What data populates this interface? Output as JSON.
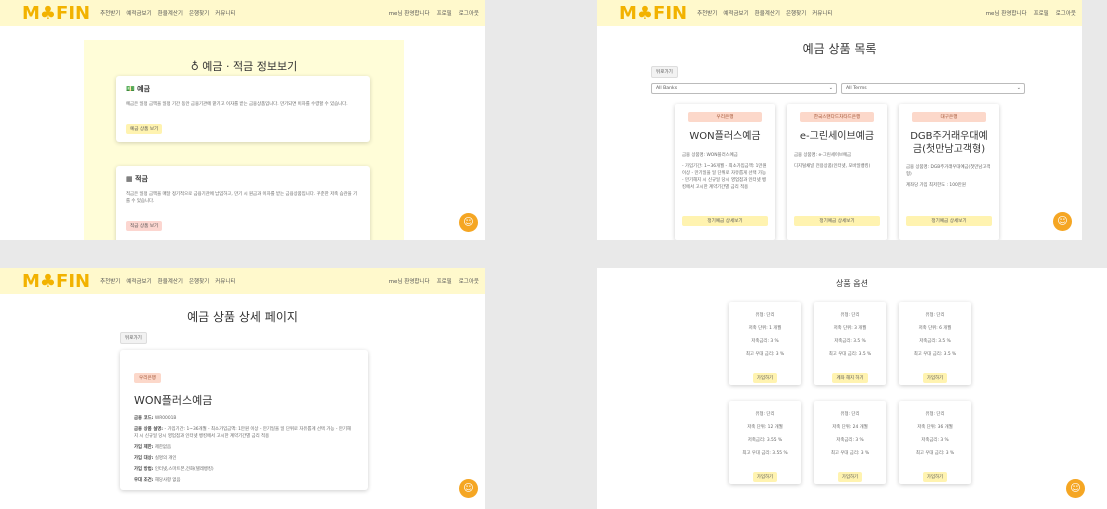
{
  "nav": {
    "logo": "M♣FIN",
    "links": [
      "추천받기",
      "예적금보기",
      "환율계산기",
      "은행찾기",
      "커뮤니티"
    ],
    "user_greeting": "me님 환영합니다",
    "profile": "프로필",
    "logout": "로그아웃"
  },
  "chat_icon": "chatbot-icon",
  "info_page": {
    "title": "♁ 예금 · 적금 정보보기",
    "deposit": {
      "heading": "💵 예금",
      "desc": "예금은 일정 금액을 일정 기간 동안 금융기관에 맡기고 이자를 받는 금융상품입니다. 만기되면 이자를 수령할 수 있습니다.",
      "button": "예금 상품 보기"
    },
    "saving": {
      "heading": "▦ 적금",
      "desc": "적금은 일정 금액을 매달 정기적으로 금융기관에 납입하고, 만기 시 원금과 이자를 받는 금융상품입니다. 꾸준한 저축 습관을 기를 수 있습니다.",
      "button": "적금 상품 보기"
    }
  },
  "list_page": {
    "title": "예금 상품 목록",
    "back": "뒤로가기",
    "bank_filter": "All Banks",
    "term_filter": "All Terms",
    "products": [
      {
        "bank": "우리은행",
        "name": "WON플러스예금",
        "lines": [
          "금융 상품명: WON플러스예금",
          "- 가입기간: 1~36개월 - 최소가입금액: 1만원 이상 - 만기일을 일 단위로 자유롭게 선택 가능 - 만기해지 시 신규일 당시 영업점과 인터넷 뱅킹에서 고시한 계약기간별 금리 적용"
        ],
        "button": "정기예금 상세보기"
      },
      {
        "bank": "한국스탠다드차타드은행",
        "name": "e-그린세이브예금",
        "lines": [
          "금융 상품명: e-그린세이브예금",
          "디지털채널 전용상품(인터넷, 모바일뱅킹)"
        ],
        "button": "정기예금 상세보기"
      },
      {
        "bank": "대구은행",
        "name": "DGB주거래우대예금(첫만남고객형)",
        "lines": [
          "금융 상품명: DGB주거래우대예금(첫만남고객형)",
          "계좌당 가입 최저한도 : 100만원"
        ],
        "button": "정기예금 상세보기"
      }
    ]
  },
  "detail_page": {
    "title": "예금 상품 상세 페이지",
    "back": "뒤로가기",
    "bank": "우리은행",
    "name": "WON플러스예금",
    "code_label": "금융 코드:",
    "code": "WR0001B",
    "desc_label": "금융 상품 설명:",
    "desc": "- 가입기간: 1~36개월 - 최소가입금액: 1만원 이상 - 만기일을 일 단위로 자유롭게 선택 가능 - 만기해지 시 신규일 당시 영업점과 인터넷 뱅킹에서 고시한 계약기간별 금리 적용",
    "restriction_label": "가입 제한:",
    "restriction": "제한없음",
    "target_label": "가입 대상:",
    "target": "실명의 개인",
    "method_label": "가입 방법:",
    "method": "인터넷,스마트폰,전화(텔레뱅킹)",
    "condition_label": "우대 조건:",
    "condition": "해당사항 없음"
  },
  "options_page": {
    "title": "상품 옵션",
    "options": [
      {
        "type": "유형: 단리",
        "term": "저축 단위: 1 개월",
        "rate": "저축금리: 3 %",
        "max_rate": "최고 우대 금리: 3 %",
        "button": "가입하기"
      },
      {
        "type": "유형: 단리",
        "term": "저축 단위: 3 개월",
        "rate": "저축금리: 3.5 %",
        "max_rate": "최고 우대 금리: 3.5 %",
        "button": "계좌 해지 하기"
      },
      {
        "type": "유형: 단리",
        "term": "저축 단위: 6 개월",
        "rate": "저축금리: 3.5 %",
        "max_rate": "최고 우대 금리: 3.5 %",
        "button": "가입하기"
      },
      {
        "type": "유형: 단리",
        "term": "저축 단위: 12 개월",
        "rate": "저축금리: 3.55 %",
        "max_rate": "최고 우대 금리: 3.55 %",
        "button": "가입하기"
      },
      {
        "type": "유형: 단리",
        "term": "저축 단위: 24 개월",
        "rate": "저축금리: 3 %",
        "max_rate": "최고 우대 금리: 3 %",
        "button": "가입하기"
      },
      {
        "type": "유형: 단리",
        "term": "저축 단위: 36 개월",
        "rate": "저축금리: 3 %",
        "max_rate": "최고 우대 금리: 3 %",
        "button": "가입하기"
      }
    ]
  }
}
